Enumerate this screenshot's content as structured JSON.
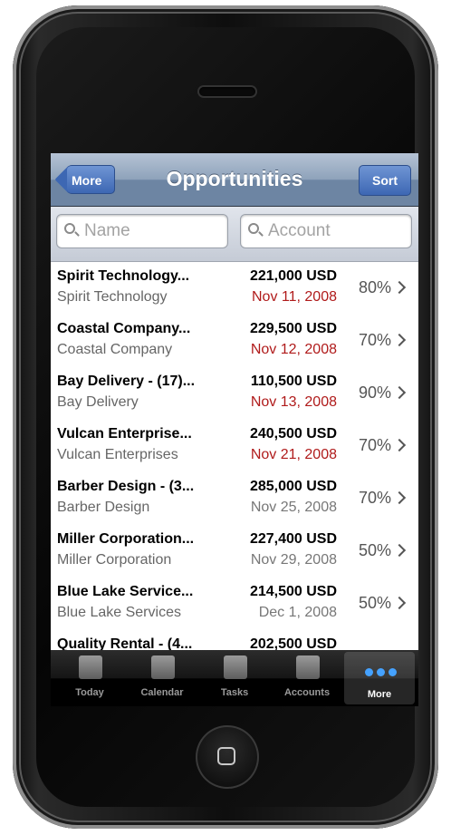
{
  "navbar": {
    "title": "Opportunities",
    "back_label": "More",
    "sort_label": "Sort"
  },
  "search": {
    "name_placeholder": "Name",
    "account_placeholder": "Account"
  },
  "rows": [
    {
      "name": "Spirit Technology...",
      "account": "Spirit Technology",
      "amount": "221,000 USD",
      "date": "Nov 11, 2008",
      "overdue": true,
      "pct": "80%"
    },
    {
      "name": "Coastal Company...",
      "account": "Coastal Company",
      "amount": "229,500 USD",
      "date": "Nov 12, 2008",
      "overdue": true,
      "pct": "70%"
    },
    {
      "name": "Bay Delivery - (17)...",
      "account": "Bay Delivery",
      "amount": "110,500 USD",
      "date": "Nov 13, 2008",
      "overdue": true,
      "pct": "90%"
    },
    {
      "name": "Vulcan Enterprise...",
      "account": "Vulcan Enterprises",
      "amount": "240,500 USD",
      "date": "Nov 21, 2008",
      "overdue": true,
      "pct": "70%"
    },
    {
      "name": "Barber Design - (3...",
      "account": "Barber Design",
      "amount": "285,000 USD",
      "date": "Nov 25, 2008",
      "overdue": false,
      "pct": "70%"
    },
    {
      "name": "Miller Corporation...",
      "account": "Miller Corporation",
      "amount": "227,400 USD",
      "date": "Nov 29, 2008",
      "overdue": false,
      "pct": "50%"
    },
    {
      "name": "Blue Lake Service...",
      "account": "Blue Lake Services",
      "amount": "214,500 USD",
      "date": "Dec 1, 2008",
      "overdue": false,
      "pct": "50%"
    },
    {
      "name": "Quality Rental - (4...",
      "account": "",
      "amount": "202,500 USD",
      "date": "",
      "overdue": false,
      "pct": ""
    }
  ],
  "tabs": [
    {
      "label": "Today",
      "icon": "today-icon"
    },
    {
      "label": "Calendar",
      "icon": "calendar-icon"
    },
    {
      "label": "Tasks",
      "icon": "tasks-icon"
    },
    {
      "label": "Accounts",
      "icon": "accounts-icon"
    },
    {
      "label": "More",
      "icon": "more-icon"
    }
  ],
  "colors": {
    "overdue": "#b01b1b",
    "active_tab_dots": "#45a2ff"
  }
}
